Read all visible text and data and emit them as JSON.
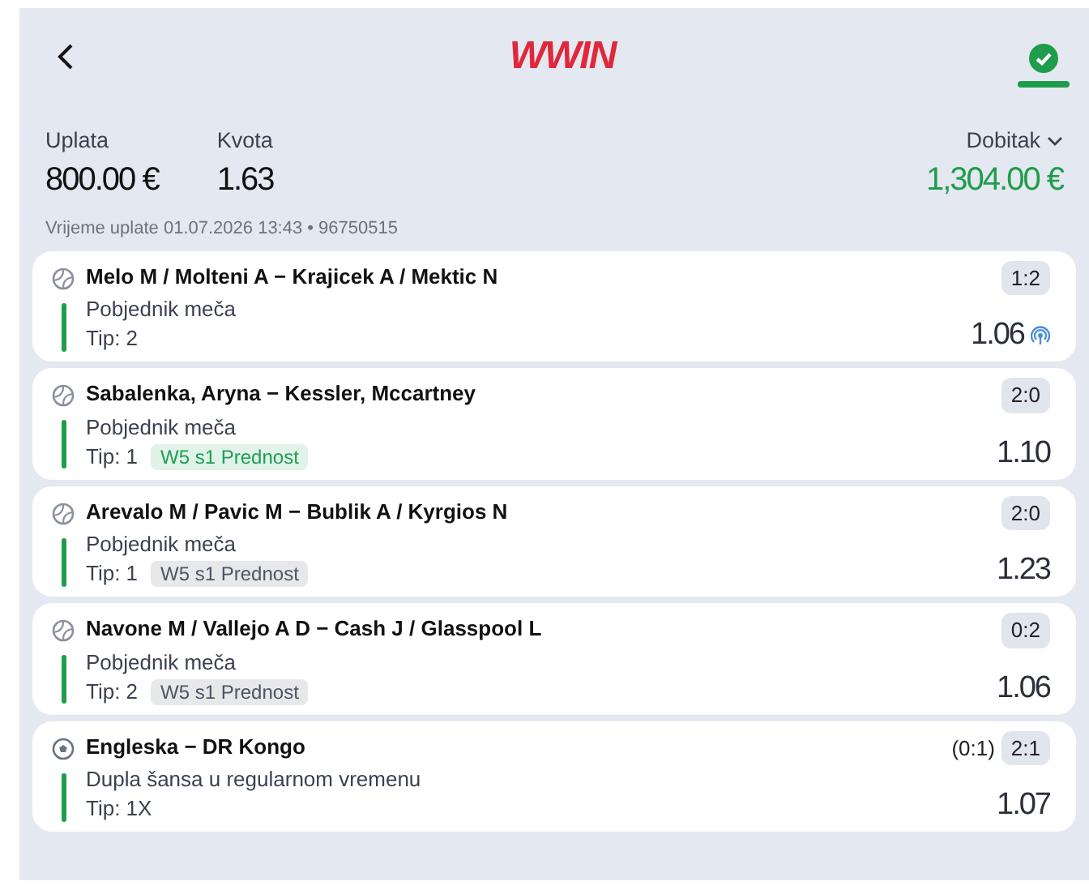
{
  "header": {
    "logo": "WWIN",
    "status_confirmed": true
  },
  "summary": {
    "stake_label": "Uplata",
    "stake": "800.00 €",
    "odds_label": "Kvota",
    "odds": "1.63",
    "payout_label": "Dobitak",
    "payout": "1,304.00 €"
  },
  "meta": "Vrijeme uplate 01.07.2026 13:43 • 96750515",
  "bets": [
    {
      "kind": "tennis",
      "match": "Melo M / Molteni A − Krajicek A / Mektic N",
      "market": "Pobjednik meča",
      "tip": "Tip: 2",
      "score": "1:2",
      "odds": "1.06",
      "live": true
    },
    {
      "kind": "tennis",
      "match": "Sabalenka, Aryna − Kessler, Mccartney",
      "market": "Pobjednik meča",
      "tip": "Tip: 1",
      "tag": {
        "text": "W5 s1 Prednost",
        "color": "#1f9d55"
      },
      "score": "2:0",
      "odds": "1.10",
      "live": false
    },
    {
      "kind": "tennis",
      "match": "Arevalo M / Pavic M − Bublik A / Kyrgios N",
      "market": "Pobjednik meča",
      "tip": "Tip: 1",
      "tag": {
        "text": "W5 s1 Prednost",
        "color": "#4b5563"
      },
      "score": "2:0",
      "odds": "1.23",
      "live": false
    },
    {
      "kind": "tennis",
      "match": "Navone M / Vallejo A D − Cash J / Glasspool L",
      "market": "Pobjednik meča",
      "tip": "Tip: 2",
      "tag": {
        "text": "W5 s1 Prednost",
        "color": "#4b5563"
      },
      "score": "0:2",
      "odds": "1.06",
      "live": false
    },
    {
      "kind": "football",
      "match": "Engleska − DR Kongo",
      "market": "Dupla šansa u regularnom vremenu",
      "tip": "Tip: 1X",
      "halftime": "(0:1)",
      "score": "2:1",
      "odds": "1.07",
      "live": false
    }
  ]
}
